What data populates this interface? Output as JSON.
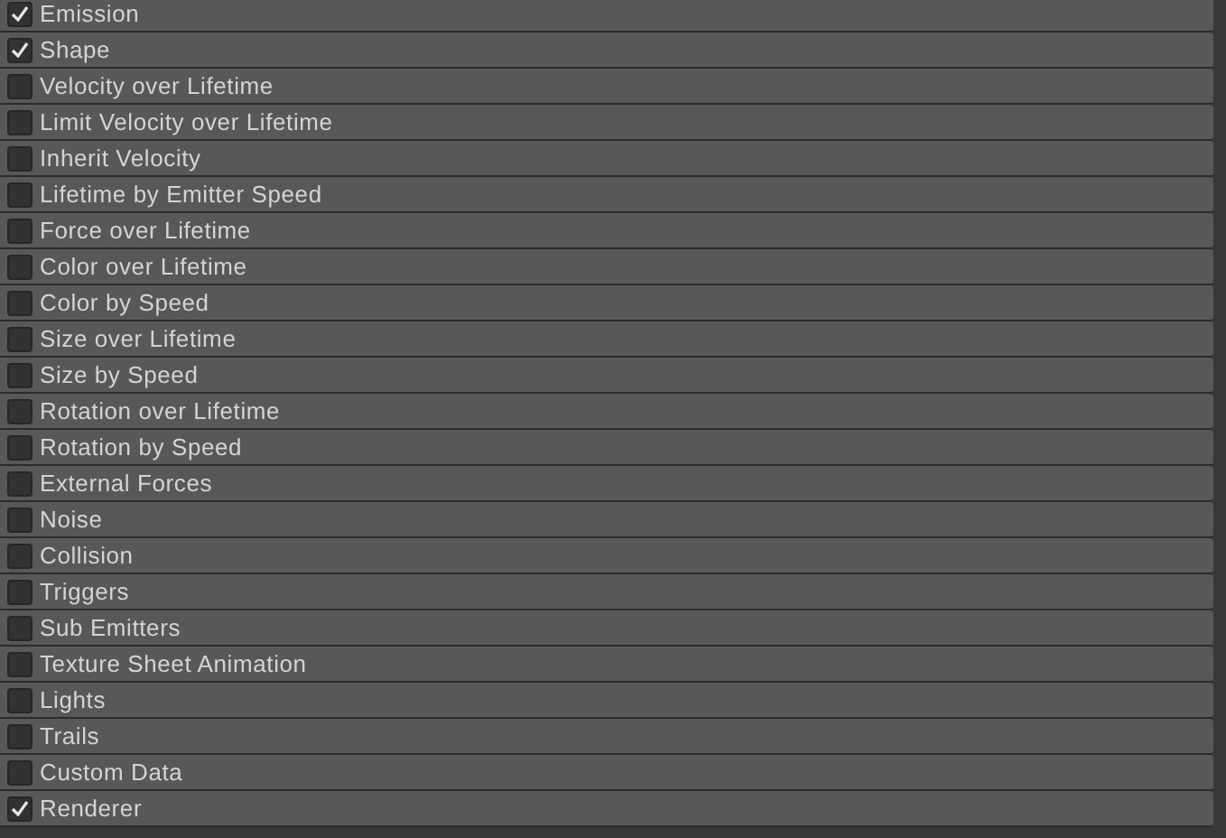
{
  "modules": [
    {
      "label": "Emission",
      "checked": true
    },
    {
      "label": "Shape",
      "checked": true
    },
    {
      "label": "Velocity over Lifetime",
      "checked": false
    },
    {
      "label": "Limit Velocity over Lifetime",
      "checked": false
    },
    {
      "label": "Inherit Velocity",
      "checked": false
    },
    {
      "label": "Lifetime by Emitter Speed",
      "checked": false
    },
    {
      "label": "Force over Lifetime",
      "checked": false
    },
    {
      "label": "Color over Lifetime",
      "checked": false
    },
    {
      "label": "Color by Speed",
      "checked": false
    },
    {
      "label": "Size over Lifetime",
      "checked": false
    },
    {
      "label": "Size by Speed",
      "checked": false
    },
    {
      "label": "Rotation over Lifetime",
      "checked": false
    },
    {
      "label": "Rotation by Speed",
      "checked": false
    },
    {
      "label": "External Forces",
      "checked": false
    },
    {
      "label": "Noise",
      "checked": false
    },
    {
      "label": "Collision",
      "checked": false
    },
    {
      "label": "Triggers",
      "checked": false
    },
    {
      "label": "Sub Emitters",
      "checked": false
    },
    {
      "label": "Texture Sheet Animation",
      "checked": false
    },
    {
      "label": "Lights",
      "checked": false
    },
    {
      "label": "Trails",
      "checked": false
    },
    {
      "label": "Custom Data",
      "checked": false
    },
    {
      "label": "Renderer",
      "checked": true
    }
  ]
}
